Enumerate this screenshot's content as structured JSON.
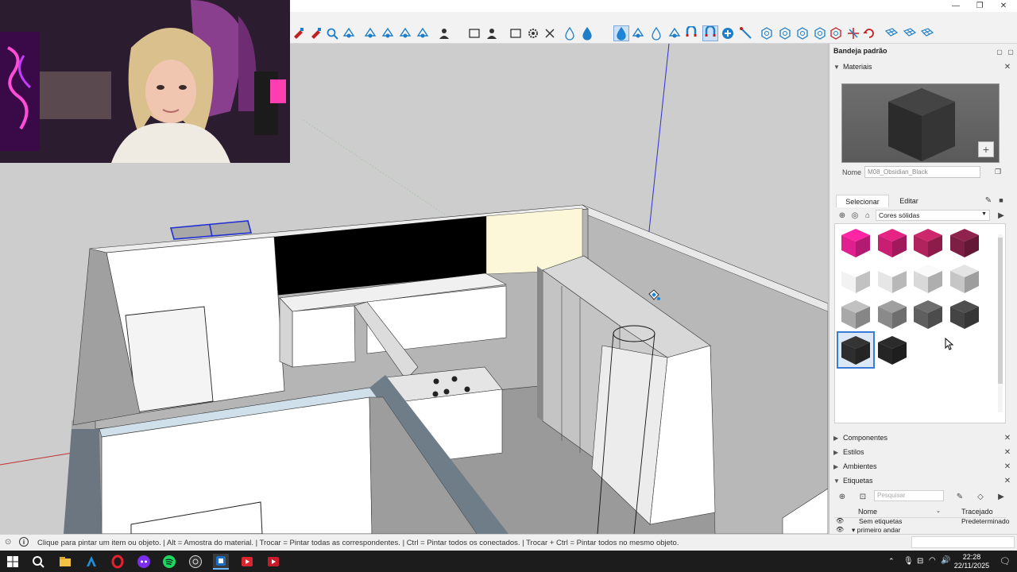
{
  "window": {
    "controls": [
      "—",
      "❐",
      "✕"
    ]
  },
  "panel": {
    "title": "Bandeja padrão",
    "materials": {
      "header": "Materiais",
      "name_label": "Nome",
      "name_value": "M08_Obsidian_Black",
      "tab_select": "Selecionar",
      "tab_edit": "Editar",
      "collection": "Cores sólidas",
      "swatch_colors": [
        "#e0208f",
        "#c81f73",
        "#b1235d",
        "#7d1e44",
        "#f2f2f2",
        "#e6e6e6",
        "#d9d9d9",
        "#c6c6c6",
        "#a8a8a8",
        "#8a8a8a",
        "#5f5f5f",
        "#444444",
        "#2d2d2d",
        "#252525"
      ],
      "selected_index": 12
    },
    "sections": [
      {
        "label": "Componentes"
      },
      {
        "label": "Estilos"
      },
      {
        "label": "Ambientes"
      },
      {
        "label": "Etiquetas"
      }
    ],
    "tags": {
      "search_placeholder": "Pesquisar",
      "col_name": "Nome",
      "col_dash": "Tracejado",
      "rows": [
        {
          "name": "Sem etiquetas",
          "dash": "Predeterminado"
        },
        {
          "name": "▾ primeiro andar",
          "dash": ""
        }
      ]
    }
  },
  "status": {
    "text": "Clique para pintar um item ou objeto. | Alt = Amostra do material. | Trocar = Pintar todas as correspondentes. | Ctrl = Pintar todos os conectados. | Trocar + Ctrl = Pintar todos no mesmo objeto."
  },
  "taskbar": {
    "time": "22:28",
    "date": "22/11/2025"
  },
  "toolbar": {
    "icons": [
      "eraser-icon",
      "paint-brush-icon",
      "zoom-icon",
      "zoom-extents-icon",
      "orbit-icon",
      "section-plane-icon",
      "section-display-icon",
      "section-cut-icon",
      "user-icon",
      "new-file-icon",
      "person-icon",
      "rectangle-icon",
      "gear-icon",
      "close-x-icon",
      "drop-icon",
      "drop-fill-icon",
      "drop-blue-icon",
      "paint-bucket-icon",
      "slash-drop-icon",
      "dots-icon",
      "magnet-icon",
      "magnet-active-icon",
      "add-circle-icon",
      "line-tool-icon",
      "hex-1-icon",
      "hex-2-icon",
      "hex-3-icon",
      "hex-4-icon",
      "hex-5-icon",
      "axes-icon",
      "refresh-icon",
      "grid-1-icon",
      "grid-2-icon",
      "grid-3-icon"
    ]
  }
}
